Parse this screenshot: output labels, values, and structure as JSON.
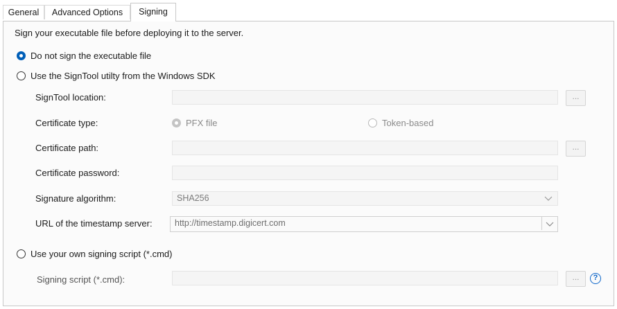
{
  "tabs": [
    {
      "label": "General",
      "active": false
    },
    {
      "label": "Advanced Options",
      "active": false
    },
    {
      "label": "Signing",
      "active": true
    }
  ],
  "intro_text": "Sign your executable file before deploying it to the server.",
  "options": {
    "no_sign": {
      "label": "Do not sign the executable file",
      "checked": true
    },
    "signtool": {
      "label": "Use the SignTool utilty from the Windows SDK",
      "checked": false
    },
    "own_script": {
      "label": "Use your own signing script (*.cmd)",
      "checked": false
    }
  },
  "signtool": {
    "location_label": "SignTool location:",
    "location_value": "",
    "browse_label": "...",
    "cert_type_label": "Certificate type:",
    "cert_type_pfx": "PFX file",
    "cert_type_token": "Token-based",
    "cert_path_label": "Certificate path:",
    "cert_path_value": "",
    "cert_password_label": "Certificate password:",
    "cert_password_value": "",
    "sig_alg_label": "Signature algorithm:",
    "sig_alg_value": "SHA256",
    "timestamp_label": "URL of the timestamp server:",
    "timestamp_value": "http://timestamp.digicert.com"
  },
  "script": {
    "label": "Signing script (*.cmd):",
    "value": "",
    "browse_label": "...",
    "help_icon": "?"
  },
  "colors": {
    "accent": "#005fb8",
    "help": "#0a64c8"
  }
}
